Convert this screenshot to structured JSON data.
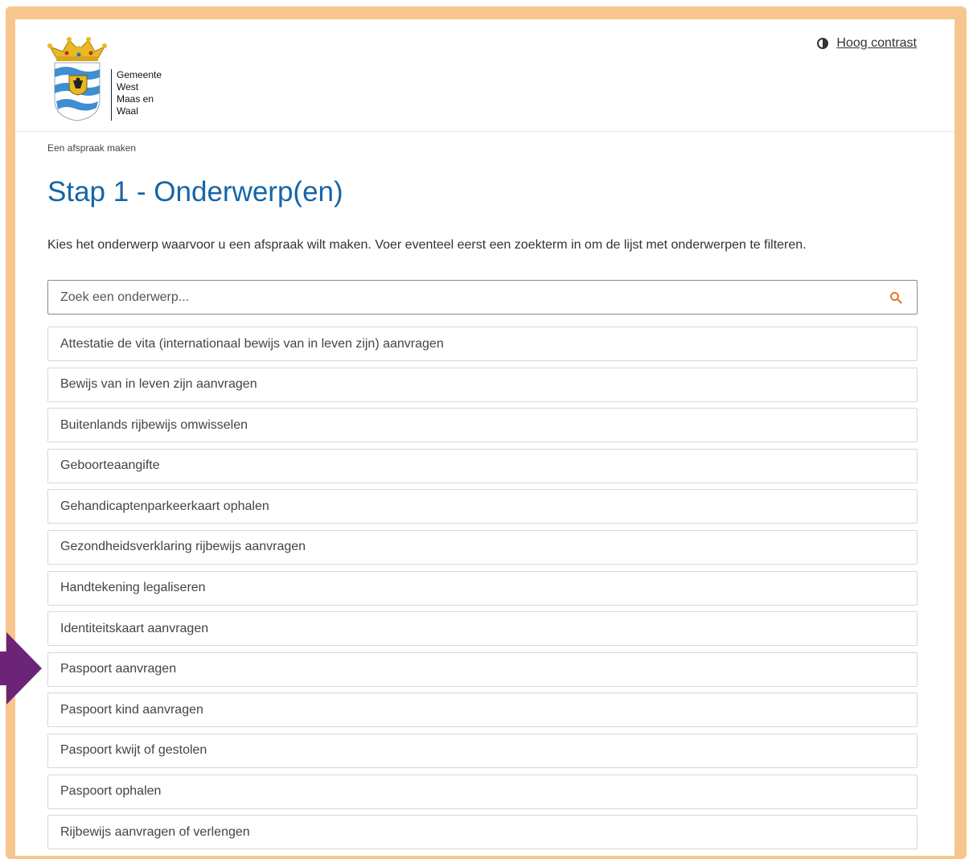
{
  "header": {
    "municipality_lines": [
      "Gemeente",
      "West",
      "Maas en",
      "Waal"
    ],
    "contrast_label": "Hoog contrast"
  },
  "breadcrumb": "Een afspraak maken",
  "title": "Stap 1 - Onderwerp(en)",
  "intro": "Kies het onderwerp waarvoor u een afspraak wilt maken. Voer eventeel eerst een zoekterm in om de lijst met onderwerpen te filteren.",
  "search": {
    "placeholder": "Zoek een onderwerp...",
    "value": ""
  },
  "topics": [
    "Attestatie de vita (internationaal bewijs van in leven zijn) aanvragen",
    "Bewijs van in leven zijn aanvragen",
    "Buitenlands rijbewijs omwisselen",
    "Geboorteaangifte",
    "Gehandicaptenparkeerkaart ophalen",
    "Gezondheidsverklaring rijbewijs aanvragen",
    "Handtekening legaliseren",
    "Identiteitskaart aanvragen",
    "Paspoort aanvragen",
    "Paspoort kind aanvragen",
    "Paspoort kwijt of gestolen",
    "Paspoort ophalen",
    "Rijbewijs aanvragen of verlengen"
  ],
  "colors": {
    "frame": "#f6c68e",
    "title": "#1565a8",
    "search_icon": "#e8742c",
    "pointer_arrow": "#6b2478"
  },
  "icons": {
    "search": "search-icon",
    "contrast": "contrast-icon",
    "pointer": "arrow-right-icon"
  }
}
